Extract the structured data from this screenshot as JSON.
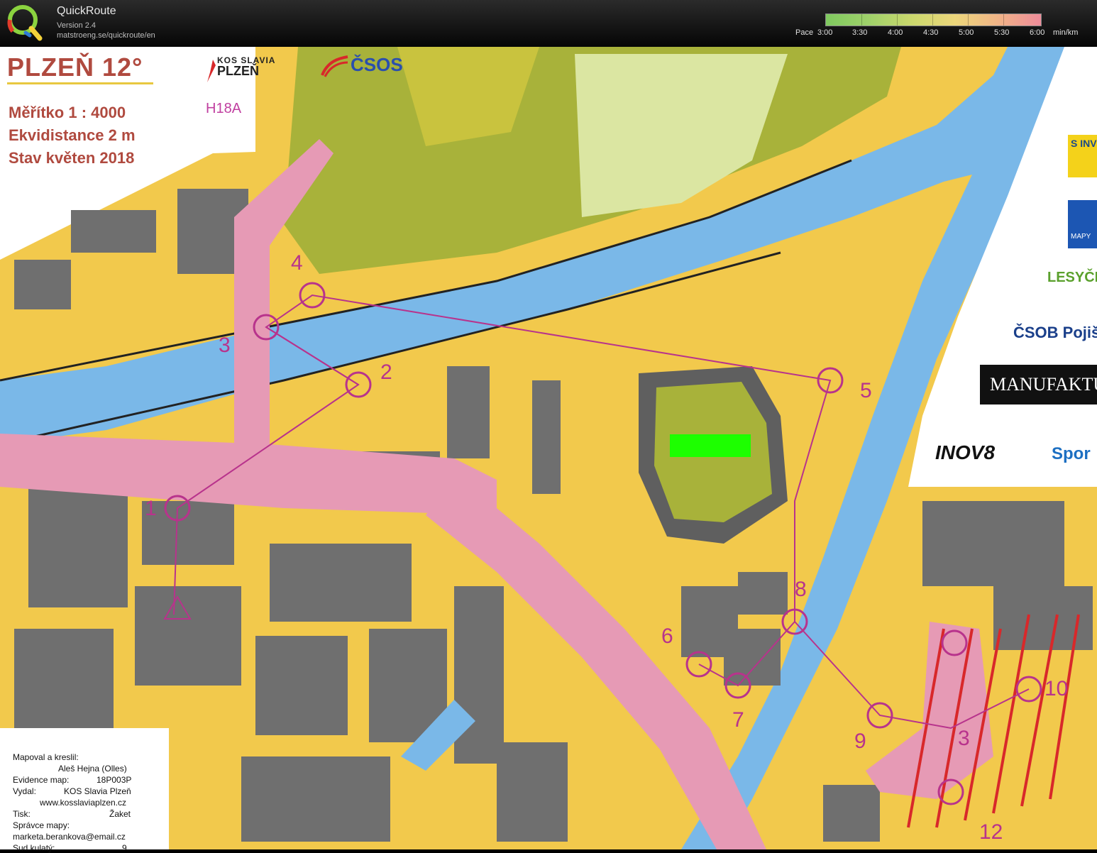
{
  "header": {
    "app_title": "QuickRoute",
    "version": "Version 2.4",
    "url": "matstroeng.se/quickroute/en",
    "logo_icon": "quickroute-q-logo-icon",
    "pace_scale": {
      "label": "Pace",
      "ticks": [
        "3:00",
        "3:30",
        "4:00",
        "4:30",
        "5:00",
        "5:30",
        "6:00"
      ],
      "unit": "min/km",
      "colors": [
        "#7fc95f",
        "#9fd16a",
        "#cbd86d",
        "#ecd67b",
        "#f0b487",
        "#ee8c9a"
      ]
    }
  },
  "map": {
    "title": "PLZEŇ 12°",
    "scale_text": "Měřítko   1 : 4000",
    "contour_text": "Ekvidistance 2 m",
    "status_text": "Stav květen 2018",
    "course_class": "H18A",
    "club_logo_line1": "KOS SLAVIA",
    "club_logo_line2": "PLZEŇ",
    "federation_logo": "ČSOS",
    "sponsors": {
      "s1": "S INV",
      "s2": "MAPY",
      "s3": "LESYČR",
      "s4": "ČSOB Pojišť",
      "s5": "MANUFAKTU",
      "s6": "INOV8",
      "s7": "Spor"
    },
    "controls": [
      {
        "number": "1"
      },
      {
        "number": "2"
      },
      {
        "number": "3"
      },
      {
        "number": "4"
      },
      {
        "number": "5"
      },
      {
        "number": "6"
      },
      {
        "number": "7"
      },
      {
        "number": "8"
      },
      {
        "number": "9"
      },
      {
        "number": "10"
      },
      {
        "number": "3"
      },
      {
        "number": "12"
      }
    ],
    "credits": {
      "mapped_label": "Mapoval a kreslil:",
      "mapped_value": "Aleš Hejna (Olles)",
      "evidence_label": "Evidence map:",
      "evidence_value": "18P003P",
      "publisher_label": "Vydal:",
      "publisher_value": "KOS Slavia Plzeň",
      "website": "www.kosslaviaplzen.cz",
      "print_label": "Tisk:",
      "print_value": "Žaket",
      "admin_label": "Správce mapy:",
      "admin_email": "marketa.berankova@email.cz",
      "partial_label": "Sud kulatý:",
      "partial_value": "9"
    },
    "colors": {
      "water": "#7ab8e8",
      "open_yellow": "#f4c33a",
      "rough_green": "#a7b03a",
      "building": "#6f6f6f",
      "paved": "#f3ead0",
      "course": "#b8338c",
      "marker": "#1dff00"
    }
  }
}
